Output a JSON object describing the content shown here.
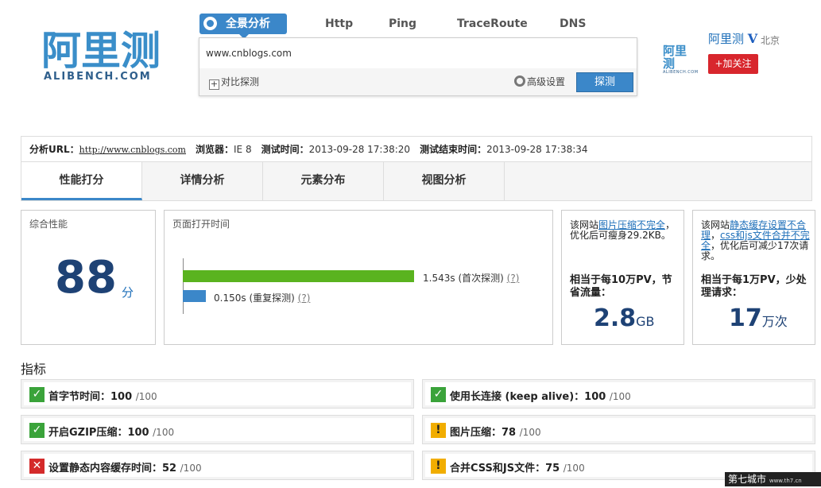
{
  "logo": {
    "cn": "阿里测",
    "en": "ALIBENCH.COM"
  },
  "nav": {
    "active": "全景分析",
    "tabs": [
      "Http",
      "Ping",
      "TraceRoute",
      "DNS"
    ]
  },
  "search": {
    "value": "www.cnblogs.com",
    "compare_label": "对比探测",
    "advanced_label": "高级设置",
    "submit_label": "探测"
  },
  "user": {
    "mini_logo": "阿里测",
    "mini_logo_sub": "ALIBENCH.COM",
    "name": "阿里测",
    "verified": "V",
    "location": "北京",
    "follow_label": "+加关注"
  },
  "info": {
    "url_label": "分析URL：",
    "url": "http://www.cnblogs.com",
    "browser_label": "浏览器：",
    "browser": "IE 8",
    "start_label": "测试时间：",
    "start": "2013-09-28 17:38:20",
    "end_label": "测试结束时间：",
    "end": "2013-09-28 17:38:34"
  },
  "tabs": [
    "性能打分",
    "详情分析",
    "元素分布",
    "视图分析"
  ],
  "score_card": {
    "title": "综合性能",
    "value": "88",
    "unit": "分"
  },
  "load_card": {
    "title": "页面打开时间",
    "first": {
      "value": "1.543s",
      "label": "(首次探测)",
      "help": "(?)",
      "seconds": 1.543
    },
    "repeat": {
      "value": "0.150s",
      "label": "(重复探测)",
      "help": "(?)",
      "seconds": 0.15
    }
  },
  "tip1": {
    "pre": "该网站",
    "link": "图片压缩不完全",
    "post": "，优化后可瘦身29.2KB。",
    "sub": "相当于每10万PV，节省流量：",
    "value": "2.8",
    "unit": "GB"
  },
  "tip2": {
    "pre": "该网站",
    "link1": "静态缓存设置不合理",
    "sep": "，",
    "link2": "css和js文件合并不完全",
    "post": "，优化后可减少17次请求。",
    "sub": "相当于每1万PV，少处理请求：",
    "value": "17",
    "unit": "万次"
  },
  "section_title": "指标",
  "metrics": [
    {
      "status": "ok",
      "name": "首字节时间：",
      "value": "100",
      "of": "/100"
    },
    {
      "status": "ok",
      "name": "使用长连接 (keep alive)：",
      "value": "100",
      "of": "/100"
    },
    {
      "status": "ok",
      "name": "开启GZIP压缩：",
      "value": "100",
      "of": "/100"
    },
    {
      "status": "warn",
      "name": "图片压缩：",
      "value": "78",
      "of": "/100"
    },
    {
      "status": "bad",
      "name": "设置静态内容缓存时间：",
      "value": "52",
      "of": "/100"
    },
    {
      "status": "warn",
      "name": "合并CSS和JS文件：",
      "value": "75",
      "of": "/100"
    }
  ],
  "watermark": {
    "text": "第七城市",
    "sub": "www.th7.cn"
  }
}
